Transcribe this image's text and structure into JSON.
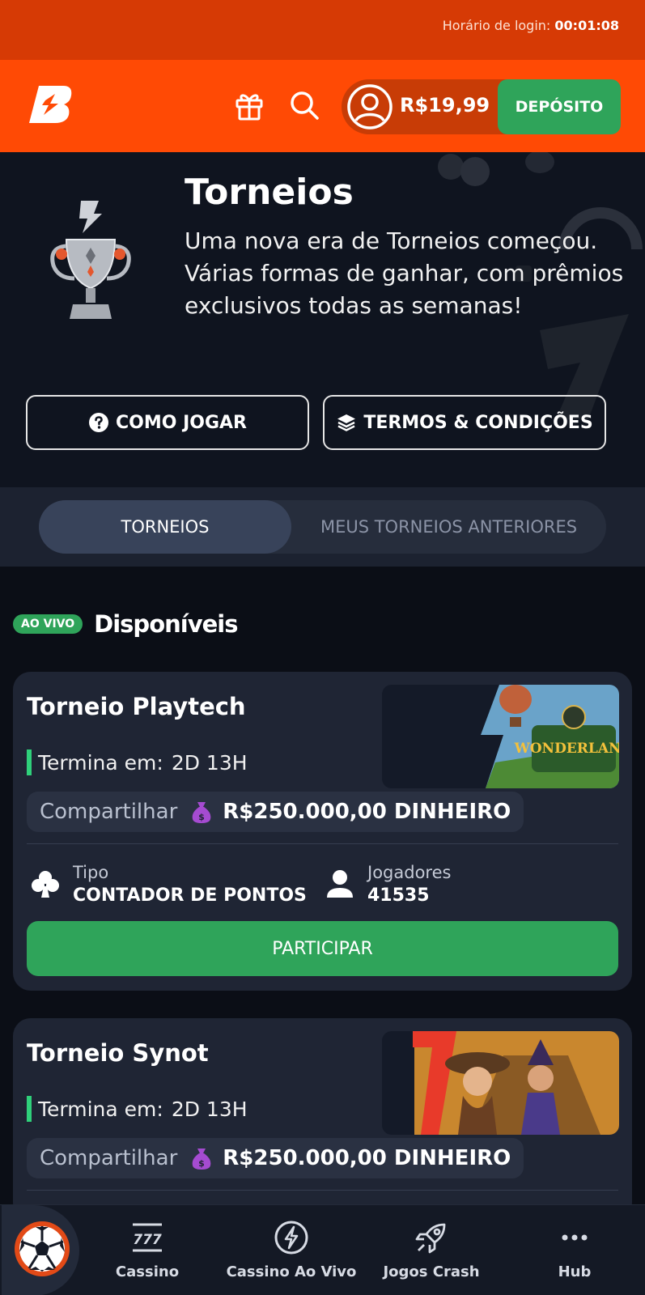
{
  "topbar": {
    "login_label": "Horário de login:",
    "login_time": "00:01:08"
  },
  "header": {
    "logo": "brand-b-logo",
    "gift": "gift-icon",
    "search": "search-icon",
    "balance": "R$19,99",
    "deposit_label": "DEPÓSITO",
    "colors": {
      "brand": "#ff4a05",
      "accent": "#2fa45a"
    }
  },
  "hero": {
    "title": "Torneios",
    "description": "Uma nova era de Torneios começou. Várias formas de ganhar, com prêmios exclusivos todas as semanas!",
    "how_to_play": "COMO JOGAR",
    "terms": "TERMOS & CONDIÇÕES"
  },
  "tabs": [
    {
      "label": "TORNEIOS",
      "active": true
    },
    {
      "label": "MEUS TORNEIOS ANTERIORES",
      "active": false
    }
  ],
  "section": {
    "badge": "AO VIVO",
    "title": "Disponíveis"
  },
  "tournaments": [
    {
      "title": "Torneio Playtech",
      "ends_label": "Termina em:",
      "ends_value": "2D 13H",
      "share_label": "Compartilhar",
      "prize": "R$250.000,00 DINHEIRO",
      "type_label": "Tipo",
      "type_value": "CONTADOR DE PONTOS",
      "players_label": "Jogadores",
      "players_value": "41535",
      "cta": "PARTICIPAR",
      "image_text": "WONDERLAND"
    },
    {
      "title": "Torneio Synot",
      "ends_label": "Termina em:",
      "ends_value": "2D 13H",
      "share_label": "Compartilhar",
      "prize": "R$250.000,00 DINHEIRO"
    }
  ],
  "bottom_nav": [
    {
      "label": "Cassino",
      "icon": "slot-777-icon"
    },
    {
      "label": "Cassino Ao Vivo",
      "icon": "lightning-icon"
    },
    {
      "label": "Jogos Crash",
      "icon": "rocket-icon"
    },
    {
      "label": "Hub",
      "icon": "more-dots-icon"
    }
  ]
}
